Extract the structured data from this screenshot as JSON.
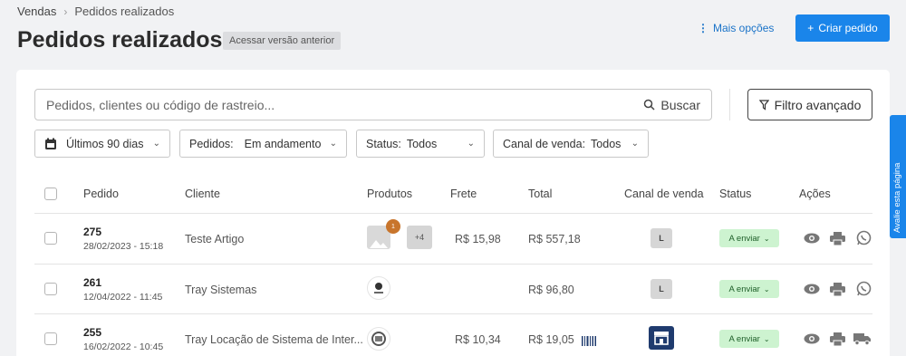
{
  "breadcrumb": {
    "root": "Vendas",
    "current": "Pedidos realizados"
  },
  "page": {
    "title": "Pedidos realizados",
    "old_version_label": "Acessar versão anterior",
    "more_options_label": "Mais opções",
    "create_order_label": "Criar pedido"
  },
  "search": {
    "placeholder": "Pedidos, clientes ou código de rastreio...",
    "button_label": "Buscar"
  },
  "advanced_filter_label": "Filtro avançado",
  "filters": {
    "date": "Últimos 90 dias",
    "orders_label": "Pedidos:",
    "orders_value": "Em andamento",
    "status_label": "Status:",
    "status_value": "Todos",
    "channel_label": "Canal de venda:",
    "channel_value": "Todos"
  },
  "table": {
    "headers": {
      "order": "Pedido",
      "client": "Cliente",
      "products": "Produtos",
      "shipping": "Frete",
      "total": "Total",
      "channel": "Canal de venda",
      "status": "Status",
      "actions": "Ações"
    },
    "rows": [
      {
        "order": "275",
        "date": "28/02/2023 - 15:18",
        "client": "Teste Artigo",
        "product_qty": "1",
        "more_products": "+4",
        "shipping": "R$ 15,98",
        "total": "R$ 557,18",
        "channel": "L",
        "status": "A enviar"
      },
      {
        "order": "261",
        "date": "12/04/2022 - 11:45",
        "client": "Tray Sistemas",
        "shipping": "",
        "total": "R$ 96,80",
        "channel": "L",
        "status": "A enviar"
      },
      {
        "order": "255",
        "date": "16/02/2022 - 10:45",
        "client": "Tray Locação de Sistema de Inter...",
        "shipping": "R$ 10,34",
        "total": "R$ 19,05",
        "channel": "",
        "status": "A enviar"
      }
    ]
  },
  "feedback_label": "Avalie esta página",
  "colors": {
    "primary": "#1a85ea",
    "status_bg": "#cdf3d0",
    "qty_badge": "#c8752c"
  }
}
